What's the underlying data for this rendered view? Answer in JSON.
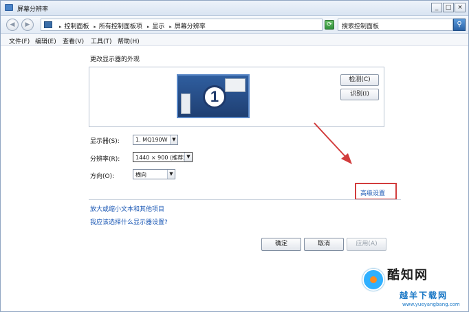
{
  "window": {
    "title": "屏幕分辨率",
    "controls": [
      "_",
      "□",
      "×"
    ]
  },
  "address": {
    "crumbs": [
      "控制面板",
      "所有控制面板项",
      "显示",
      "屏幕分辨率"
    ],
    "search_placeholder": "搜索控制面板"
  },
  "menu": [
    "文件(F)",
    "编辑(E)",
    "查看(V)",
    "工具(T)",
    "帮助(H)"
  ],
  "main": {
    "heading": "更改显示器的外观",
    "monitor_number": "1",
    "detect_label": "检测(C)",
    "identify_label": "识别(I)",
    "display_label": "显示器(S):",
    "display_value": "1. MQ190W",
    "resolution_label": "分辨率(R):",
    "resolution_value": "1440 × 900 (推荐)",
    "orientation_label": "方向(O):",
    "orientation_value": "横向",
    "advanced_link": "高级设置",
    "link_text_size": "放大或缩小文本和其他项目",
    "link_which_settings": "我应该选择什么显示器设置?",
    "ok_label": "确定",
    "cancel_label": "取消",
    "apply_label": "应用(A)"
  },
  "watermark": {
    "title": "酷知网",
    "subtitle": "越羊下载网",
    "url": "www.yueyangbang.com"
  },
  "colors": {
    "highlight_box": "#d23c3c",
    "link": "#1a57b4",
    "monitor": "#2f5e9f"
  }
}
